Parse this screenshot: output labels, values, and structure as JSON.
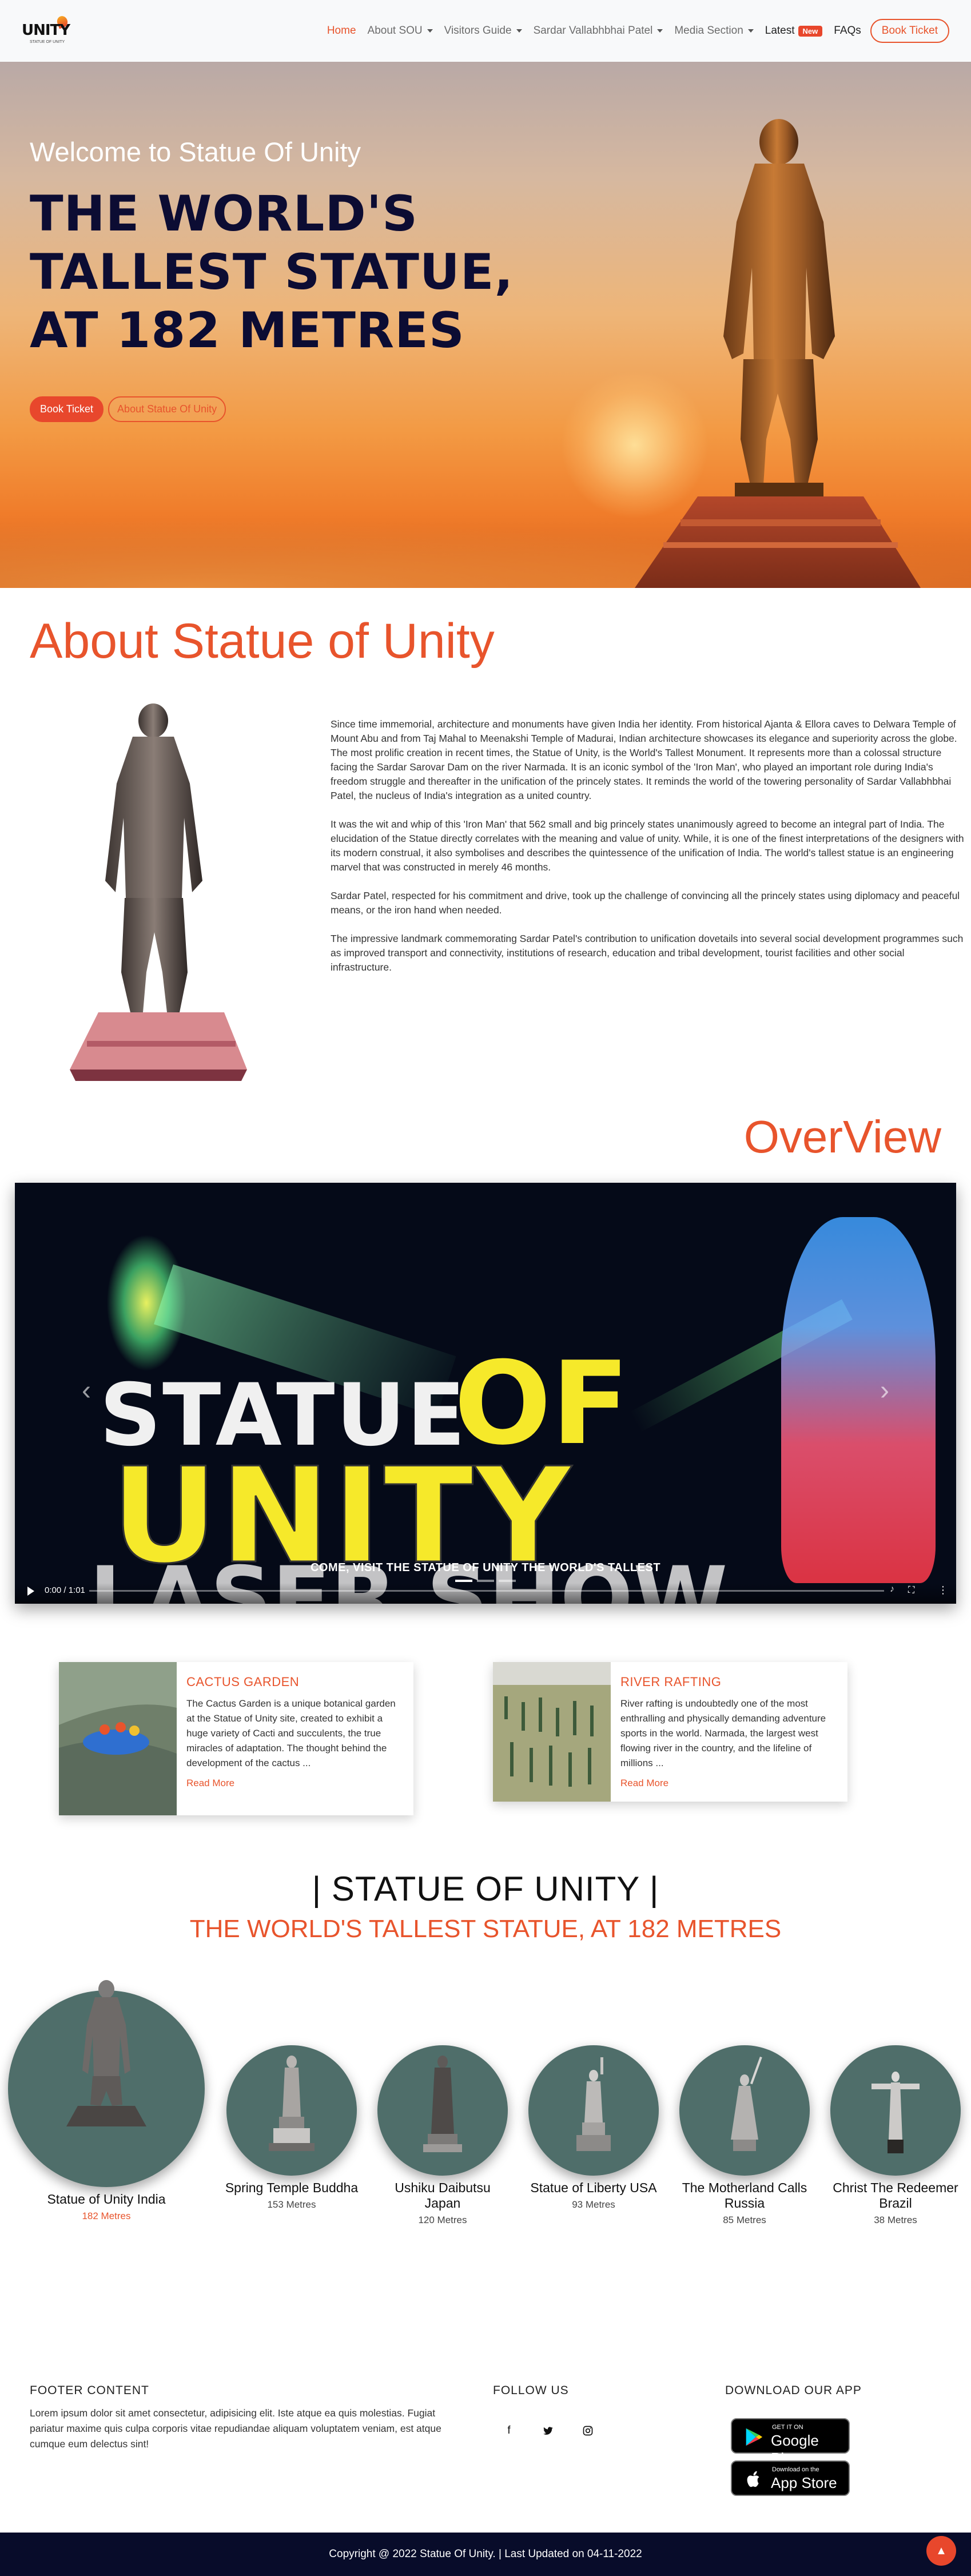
{
  "nav": {
    "logo_text": "UNITY",
    "logo_sub": "STATUE OF UNITY",
    "items": [
      {
        "label": "Home"
      },
      {
        "label": "About SOU"
      },
      {
        "label": "Visitors Guide"
      },
      {
        "label": "Sardar Vallabhbhai Patel"
      },
      {
        "label": "Media Section"
      },
      {
        "label": "Latest"
      },
      {
        "label": "FAQs"
      }
    ],
    "new_badge": "New",
    "book_button": "Book Ticket"
  },
  "hero": {
    "welcome": "Welcome to Statue Of Unity",
    "title": "THE WORLD'S TALLEST STATUE, AT 182 METRES",
    "book_button": "Book Ticket",
    "about_button": "About Statue Of Unity"
  },
  "about": {
    "title": "About Statue of Unity",
    "paragraphs": [
      "Since time immemorial, architecture and monuments have given India her identity. From historical Ajanta & Ellora caves to Delwara Temple of Mount Abu and from Taj Mahal to Meenakshi Temple of Madurai, Indian architecture showcases its elegance and superiority across the globe. The most prolific creation in recent times, the Statue of Unity, is the World's Tallest Monument. It represents more than a colossal structure facing the Sardar Sarovar Dam on the river Narmada. It is an iconic symbol of the 'Iron Man', who played an important role during India's freedom struggle and thereafter in the unification of the princely states. It reminds the world of the towering personality of Sardar Vallabhbhai Patel, the nucleus of India's integration as a united country.",
      "It was the wit and whip of this 'Iron Man' that 562 small and big princely states unanimously agreed to become an integral part of India. The elucidation of the Statue directly correlates with the meaning and value of unity. While, it is one of the finest interpretations of the designers with its modern construal, it also symbolises and describes the quintessence of the unification of India. The world's tallest statue is an engineering marvel that was constructed in merely 46 months.",
      "Sardar Patel, respected for his commitment and drive, took up the challenge of convincing all the princely states using diplomacy and peaceful means, or the iron hand when needed.",
      "The impressive landmark commemorating Sardar Patel's contribution to unification dovetails into several social development programmes such as improved transport and connectivity, institutions of research, education and tribal development, tourist facilities and other social infrastructure."
    ]
  },
  "overview": {
    "title": "OverView",
    "video_words": [
      "STATUE",
      "OF",
      "UNITY",
      "LASER SHOW"
    ],
    "caption": "COME, VISIT THE STATUE OF UNITY THE WORLD'S TALLEST",
    "time": "0:00 / 1:01"
  },
  "cards": [
    {
      "title": "CACTUS GARDEN",
      "text": "The Cactus Garden is a unique botanical garden at the Statue of Unity site, created to exhibit a huge variety of Cacti and succulents, the true miracles of adaptation. The thought behind the development of the cactus ...",
      "link": "Read More"
    },
    {
      "title": "RIVER RAFTING",
      "text": "River rafting is undoubtedly one of the most enthralling and physically demanding adventure sports in the world. Narmada, the largest west flowing river in the country, and the lifeline of millions ...",
      "link": "Read More"
    }
  ],
  "sou_heading": {
    "title": "| STATUE OF UNITY |",
    "subtitle": "THE WORLD'S TALLEST STATUE, AT 182 METRES"
  },
  "statues": [
    {
      "name": "Statue of Unity India",
      "height": "182 Metres"
    },
    {
      "name": "Spring Temple Buddha",
      "height": "153 Metres"
    },
    {
      "name": "Ushiku Daibutsu Japan",
      "height": "120 Metres"
    },
    {
      "name": "Statue of Liberty USA",
      "height": "93 Metres"
    },
    {
      "name": "The Motherland Calls Russia",
      "height": "85 Metres"
    },
    {
      "name": "Christ The Redeemer Brazil",
      "height": "38 Metres"
    }
  ],
  "footer": {
    "content_title": "FOOTER CONTENT",
    "content_text": "Lorem ipsum dolor sit amet consectetur, adipisicing elit. Iste atque ea quis molestias. Fugiat pariatur maxime quis culpa corporis vitae repudiandae aliquam voluptatem veniam, est atque cumque eum delectus sint!",
    "follow_title": "FOLLOW US",
    "app_title": "DOWNLOAD OUR APP",
    "google_small": "GET IT ON",
    "google_big": "Google Play",
    "apple_small": "Download on the",
    "apple_big": "App Store",
    "copyright": "Copyright @ 2022 Statue Of Unity. | Last Updated on 04-11-2022"
  },
  "colors": {
    "accent": "#e8542c",
    "navy": "#080c2a",
    "circle": "#4f6e6a"
  }
}
